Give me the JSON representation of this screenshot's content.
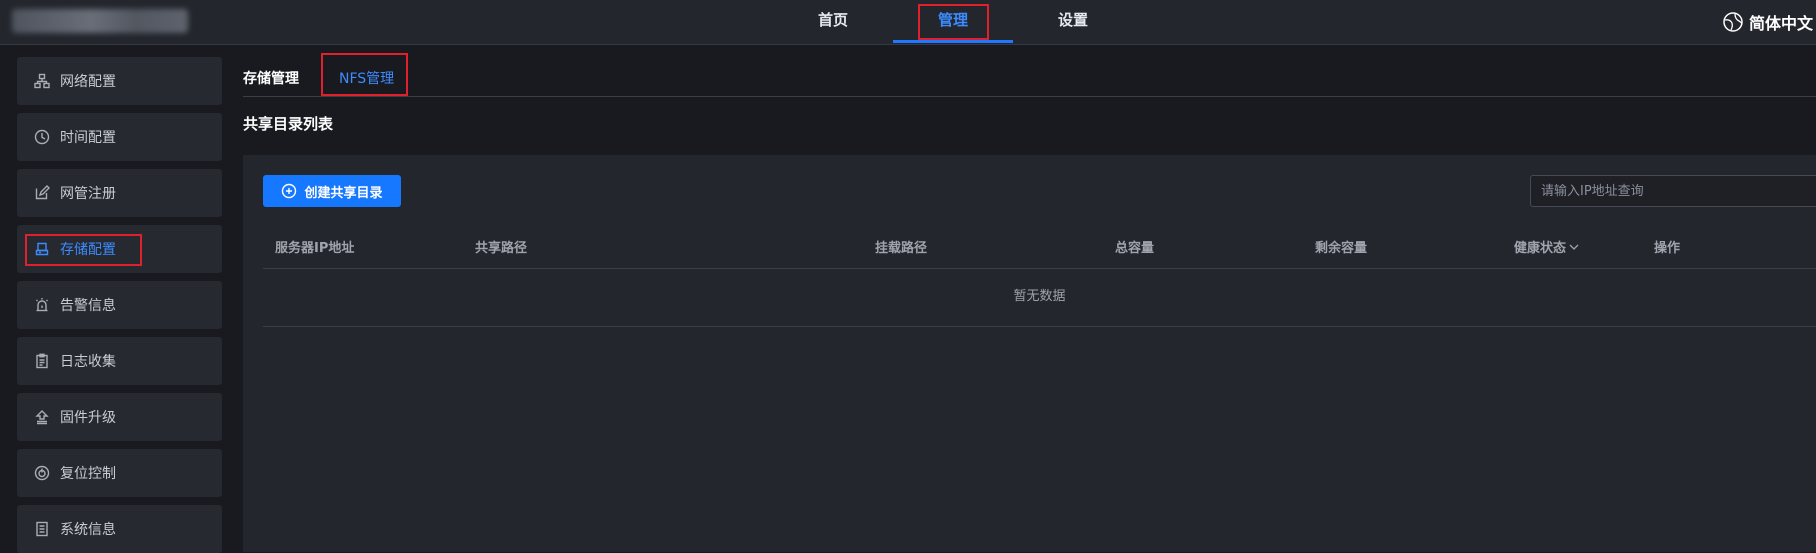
{
  "header": {
    "nav": [
      {
        "label": "首页"
      },
      {
        "label": "管理"
      },
      {
        "label": "设置"
      }
    ],
    "language": "简体中文"
  },
  "sidebar": {
    "items": [
      {
        "label": "网络配置",
        "icon": "network-icon"
      },
      {
        "label": "时间配置",
        "icon": "clock-icon"
      },
      {
        "label": "网管注册",
        "icon": "edit-icon"
      },
      {
        "label": "存储配置",
        "icon": "storage-icon"
      },
      {
        "label": "告警信息",
        "icon": "alarm-icon"
      },
      {
        "label": "日志收集",
        "icon": "clipboard-icon"
      },
      {
        "label": "固件升级",
        "icon": "upgrade-icon"
      },
      {
        "label": "复位控制",
        "icon": "power-icon"
      },
      {
        "label": "系统信息",
        "icon": "document-icon"
      }
    ],
    "active": "存储配置"
  },
  "main": {
    "tabs": [
      {
        "label": "存储管理"
      },
      {
        "label": "NFS管理"
      }
    ],
    "active_tab": "NFS管理",
    "section_title": "共享目录列表",
    "create_button": "创建共享目录",
    "search_placeholder": "请输入IP地址查询",
    "columns": [
      "服务器IP地址",
      "共享路径",
      "挂载路径",
      "总容量",
      "剩余容量",
      "健康状态",
      "操作"
    ],
    "empty_text": "暂无数据"
  },
  "colors": {
    "accent": "#1677ff",
    "highlight_box": "#e0202a",
    "background": "#181a1f",
    "panel": "#23262d"
  }
}
